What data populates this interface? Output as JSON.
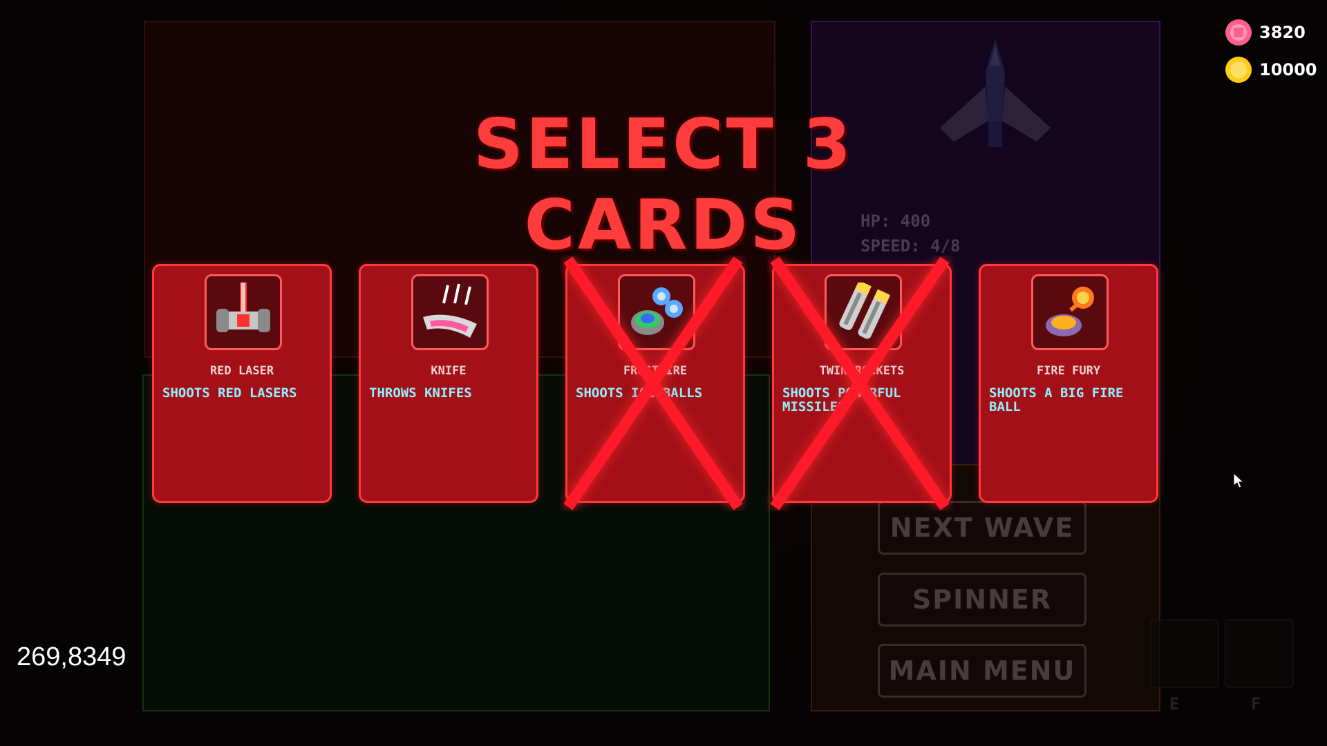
{
  "title": "SELECT 3 CARDS",
  "currency": {
    "gems": "3820",
    "coins": "10000"
  },
  "coords": "269,8349",
  "stats_panel": {
    "hp": "HP: 400",
    "speed": "SPEED: 4/8"
  },
  "menu": {
    "next_wave": "NEXT WAVE",
    "spinner": "SPINNER",
    "main_menu": "MAIN MENU"
  },
  "slots": {
    "key_e": "E",
    "key_f": "F"
  },
  "cards": [
    {
      "title": "RED LASER",
      "desc": "SHOOTS RED LASERS",
      "icon": "red-laser-icon",
      "crossed": false
    },
    {
      "title": "KNIFE",
      "desc": "THROWS KNIFES",
      "icon": "knife-icon",
      "crossed": false
    },
    {
      "title": "FROSTFIRE",
      "desc": "SHOOTS ICE BALLS",
      "icon": "frost-fire-icon",
      "crossed": true
    },
    {
      "title": "TWIN ROCKETS",
      "desc": "SHOOTS POWERFUL MISSILES",
      "icon": "twin-rockets-icon",
      "crossed": true
    },
    {
      "title": "FIRE FURY",
      "desc": "SHOOTS A BIG FIRE BALL",
      "icon": "fire-fury-icon",
      "crossed": false
    }
  ],
  "colors": {
    "accent_red": "#ff3c3c",
    "card_bg": "#a41018",
    "desc_cyan": "#8ff0ff",
    "gem_pink": "#ff5f8f",
    "coin_gold": "#ffcc1a"
  }
}
